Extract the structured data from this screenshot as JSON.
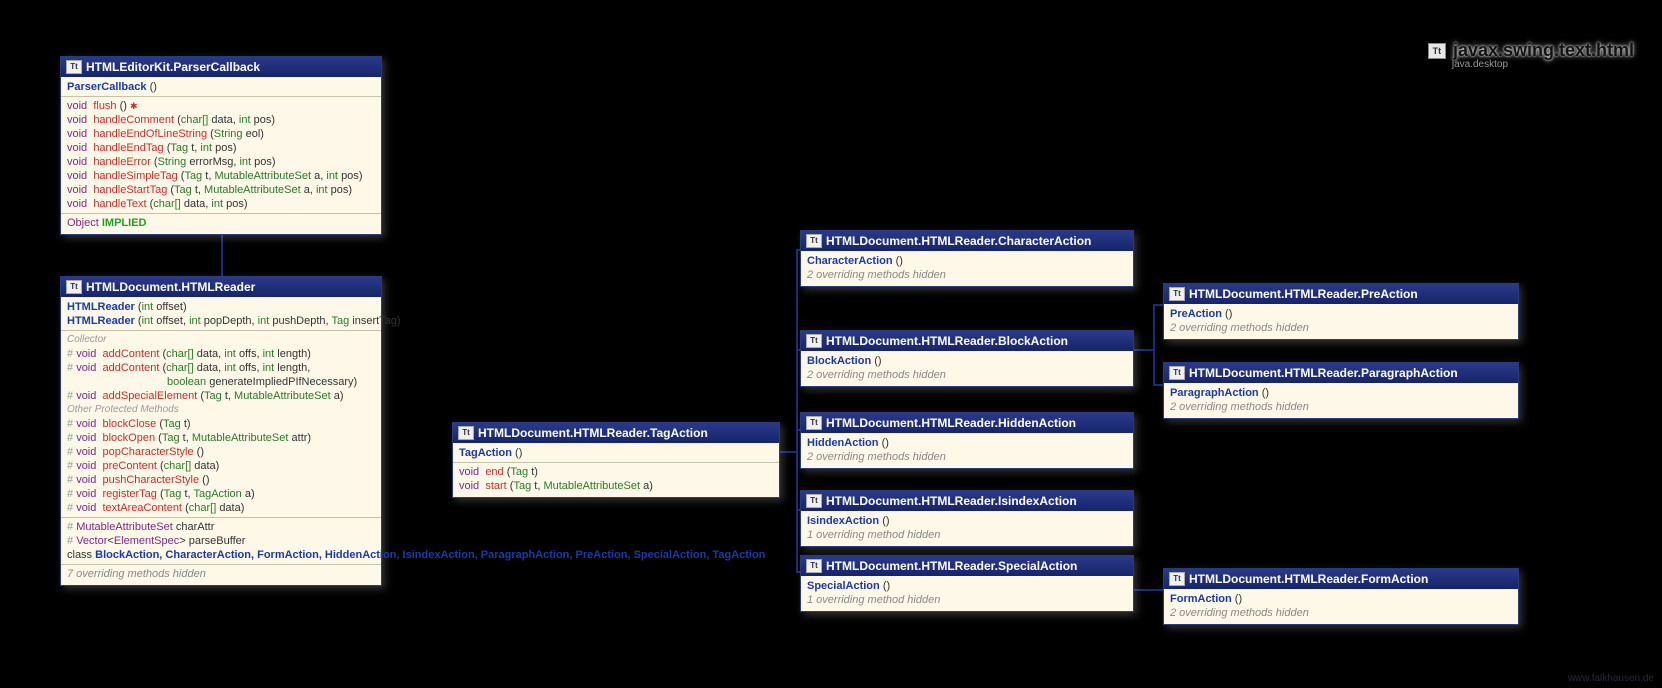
{
  "package": {
    "name": "javax.swing.text.html",
    "module": "java.desktop"
  },
  "icon_tt": "Tt",
  "watermark": "www.falkhausen.de",
  "parserCallback": {
    "title": "HTMLEditorKit.ParserCallback",
    "ctor": "ParserCallback",
    "m_flush": "flush",
    "m_handleComment": "handleComment",
    "m_handleEndOfLineString": "handleEndOfLineString",
    "m_handleEndTag": "handleEndTag",
    "m_handleError": "handleError",
    "m_handleSimpleTag": "handleSimpleTag",
    "m_handleStartTag": "handleStartTag",
    "m_handleText": "handleText",
    "f_implied": "IMPLIED",
    "f_implied_type": "Object",
    "t_void": "void",
    "t_String": "String",
    "t_Tag": "Tag",
    "t_MutableAttributeSet": "MutableAttributeSet",
    "t_charArr": "char[]",
    "t_int": "int",
    "p_data": "data",
    "p_pos": "pos",
    "p_eol": "eol",
    "p_t": "t",
    "p_a": "a",
    "p_errorMsg": "errorMsg",
    "throws_mark": "✱"
  },
  "htmlReader": {
    "title": "HTMLDocument.HTMLReader",
    "ctor": "HTMLReader",
    "t_int": "int",
    "t_Tag": "Tag",
    "t_TagAction": "TagAction",
    "t_MutableAttributeSet": "MutableAttributeSet",
    "t_charArr": "char[]",
    "t_boolean": "boolean",
    "t_void": "void",
    "t_Vector": "Vector",
    "t_ElementSpec": "ElementSpec",
    "p_offset": "offset",
    "p_popDepth": "popDepth",
    "p_pushDepth": "pushDepth",
    "p_insertTag": "insertTag",
    "p_data": "data",
    "p_offs": "offs",
    "p_length": "length",
    "p_generate": "generateImpliedPIfNecessary",
    "p_t": "t",
    "p_a": "a",
    "p_attr": "attr",
    "sec_collector": "Collector",
    "sec_other": "Other Protected Methods",
    "m_addContent": "addContent",
    "m_addSpecialElement": "addSpecialElement",
    "m_blockClose": "blockClose",
    "m_blockOpen": "blockOpen",
    "m_popCharacterStyle": "popCharacterStyle",
    "m_preContent": "preContent",
    "m_pushCharacterStyle": "pushCharacterStyle",
    "m_registerTag": "registerTag",
    "m_textAreaContent": "textAreaContent",
    "f_charAttr": "charAttr",
    "f_parseBuffer": "parseBuffer",
    "class_kw": "class",
    "classes": "BlockAction, CharacterAction, FormAction, HiddenAction, IsindexAction, ParagraphAction, PreAction, SpecialAction, TagAction",
    "overriding": "7 overriding",
    "methods_hidden": "methods hidden"
  },
  "tagAction": {
    "title": "HTMLDocument.HTMLReader.TagAction",
    "ctor": "TagAction",
    "t_void": "void",
    "t_Tag": "Tag",
    "t_MutableAttributeSet": "MutableAttributeSet",
    "m_end": "end",
    "m_start": "start",
    "p_t": "t",
    "p_a": "a"
  },
  "characterAction": {
    "title": "HTMLDocument.HTMLReader.CharacterAction",
    "ctor": "CharacterAction",
    "overriding": "2 overriding",
    "methods_hidden": "methods hidden"
  },
  "blockAction": {
    "title": "HTMLDocument.HTMLReader.BlockAction",
    "ctor": "BlockAction",
    "overriding": "2 overriding",
    "methods_hidden": "methods hidden"
  },
  "hiddenAction": {
    "title": "HTMLDocument.HTMLReader.HiddenAction",
    "ctor": "HiddenAction",
    "overriding": "2 overriding",
    "methods_hidden": "methods hidden"
  },
  "isindexAction": {
    "title": "HTMLDocument.HTMLReader.IsindexAction",
    "ctor": "IsindexAction",
    "overriding": "1 overriding",
    "methods_hidden": "method hidden"
  },
  "specialAction": {
    "title": "HTMLDocument.HTMLReader.SpecialAction",
    "ctor": "SpecialAction",
    "overriding": "1 overriding",
    "methods_hidden": "method hidden"
  },
  "preAction": {
    "title": "HTMLDocument.HTMLReader.PreAction",
    "ctor": "PreAction",
    "overriding": "2 overriding",
    "methods_hidden": "methods hidden"
  },
  "paragraphAction": {
    "title": "HTMLDocument.HTMLReader.ParagraphAction",
    "ctor": "ParagraphAction",
    "overriding": "2 overriding",
    "methods_hidden": "methods hidden"
  },
  "formAction": {
    "title": "HTMLDocument.HTMLReader.FormAction",
    "ctor": "FormAction",
    "overriding": "2 overriding",
    "methods_hidden": "methods hidden"
  }
}
